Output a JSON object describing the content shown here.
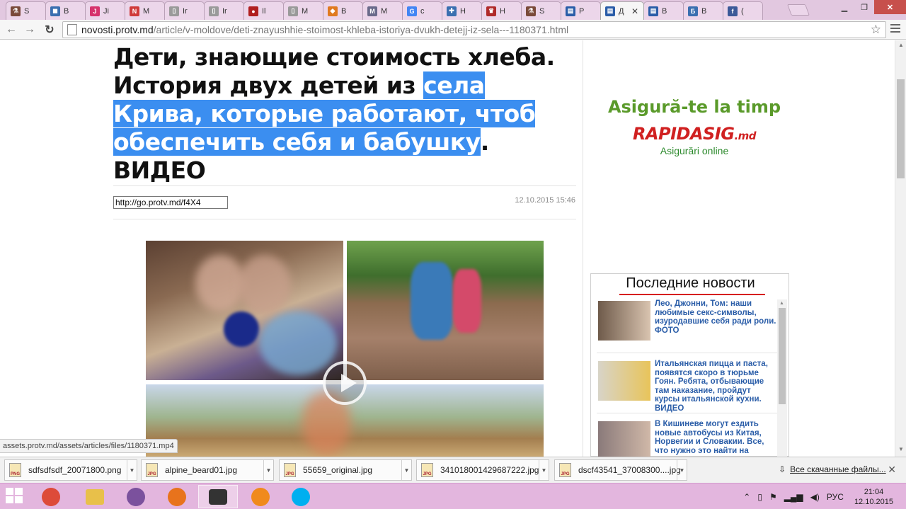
{
  "tabs": [
    {
      "title": "S",
      "color": "#7a4a3a",
      "glyph": "⚗"
    },
    {
      "title": "B",
      "color": "#3a6fb0",
      "glyph": "◼"
    },
    {
      "title": "Ji",
      "color": "#d6336c",
      "glyph": "J"
    },
    {
      "title": "M",
      "color": "#d03a3a",
      "glyph": "N"
    },
    {
      "title": "Ir",
      "color": "#9a9a9a",
      "glyph": "▯"
    },
    {
      "title": "Ir",
      "color": "#9a9a9a",
      "glyph": "▯"
    },
    {
      "title": "Il",
      "color": "#b01f1f",
      "glyph": "●"
    },
    {
      "title": "M",
      "color": "#9a9a9a",
      "glyph": "▯"
    },
    {
      "title": "B",
      "color": "#e07a20",
      "glyph": "◆"
    },
    {
      "title": "M",
      "color": "#6a6a8a",
      "glyph": "M"
    },
    {
      "title": "c",
      "color": "#4285f4",
      "glyph": "G"
    },
    {
      "title": "H",
      "color": "#3a6fb0",
      "glyph": "✚"
    },
    {
      "title": "H",
      "color": "#b02a2a",
      "glyph": "♛"
    },
    {
      "title": "S",
      "color": "#7a4a3a",
      "glyph": "⚗"
    },
    {
      "title": "P",
      "color": "#2a5da8",
      "glyph": "▤"
    },
    {
      "title": "Д",
      "color": "#2a5da8",
      "glyph": "▤",
      "active": true
    },
    {
      "title": "B",
      "color": "#2a5da8",
      "glyph": "▤"
    },
    {
      "title": "B",
      "color": "#3a6fb0",
      "glyph": "Б"
    },
    {
      "title": "(",
      "color": "#3b5998",
      "glyph": "f"
    }
  ],
  "window": {
    "minimize": "▁",
    "restore": "❐",
    "close": "✕",
    "tab_close": "✕"
  },
  "toolbar": {
    "back": "←",
    "forward": "→",
    "reload": "↻",
    "url_host": "novosti.protv.md",
    "url_path": "/article/v-moldove/deti-znayushhie-stoimost-khleba-istoriya-dvukh-detejj-iz-sela---1180371.html",
    "star": "☆"
  },
  "article": {
    "headline_part1": "Дети, знающие стоимость хлеба. История двух детей из ",
    "headline_selected": "села Крива, которые работают, чтоб обеспечить себя и бабушку",
    "headline_part2": ". ВИДЕО",
    "short_link": "http://go.protv.md/f4X4",
    "date": "12.10.2015 15:46"
  },
  "ad": {
    "title": "Asigură-te la timp",
    "brand": "RAPIDASIG",
    "brand_suffix": ".md",
    "subtitle": "Asigurări online"
  },
  "news": {
    "title": "Последние новости",
    "items": [
      {
        "text": "Лео, Джонни, Том: наши любимые секс-символы, изуродавшие себя ради роли. ФОТО",
        "thumb": [
          "#6e5a4a",
          "#d9c4b0"
        ]
      },
      {
        "text": "Итальянская пицца и паста, появятся скоро в тюрьме Гоян. Ребята, отбывающие там наказание, пройдут курсы итальянской кухни. ВИДЕО",
        "thumb": [
          "#d8d4c8",
          "#e8c45a"
        ]
      },
      {
        "text": "В Кишиневе могут ездить новые автобусы из Китая, Норвегии и Словакии. Все, что нужно это найти на",
        "thumb": [
          "#8a7a7a",
          "#d0b8a8"
        ]
      }
    ]
  },
  "statusbar": {
    "text": "assets.protv.md/assets/articles/files/1180371.mp4"
  },
  "downloads": {
    "files": [
      {
        "name": "sdfsdfsdf_20071800.png",
        "type": "PNG"
      },
      {
        "name": "alpine_beard01.jpg",
        "type": "JPG"
      },
      {
        "name": "55659_original.jpg",
        "type": "JPG"
      },
      {
        "name": "341018001429687222.jpg",
        "type": "JPG"
      },
      {
        "name": "dscf43541_37008300....jpg",
        "type": "JPG"
      }
    ],
    "show_all": "Все скачанные файлы...",
    "close": "✕"
  },
  "taskbar": {
    "apps": [
      {
        "name": "chrome",
        "color": "#dd4b39"
      },
      {
        "name": "explorer",
        "color": "#e8c04a"
      },
      {
        "name": "viber",
        "color": "#7b519d"
      },
      {
        "name": "firefox",
        "color": "#e8731c"
      },
      {
        "name": "camera",
        "color": "#333333",
        "active": true
      },
      {
        "name": "messenger",
        "color": "#f08a1c"
      },
      {
        "name": "skype",
        "color": "#00aff0"
      }
    ],
    "lang": "РУС",
    "time": "21:04",
    "date": "12.10.2015"
  }
}
